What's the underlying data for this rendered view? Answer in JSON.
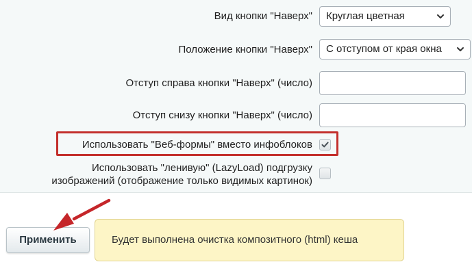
{
  "settings": {
    "button_type": {
      "label": "Вид кнопки \"Наверх\"",
      "value": "Круглая цветная"
    },
    "button_position": {
      "label": "Положение кнопки \"Наверх\"",
      "value": "С отступом от края окна"
    },
    "offset_right": {
      "label": "Отступ справа кнопки \"Наверх\" (число)",
      "value": ""
    },
    "offset_bottom": {
      "label": "Отступ снизу кнопки \"Наверх\" (число)",
      "value": ""
    },
    "use_webforms": {
      "label": "Использовать \"Веб-формы\" вместо инфоблоков",
      "checked": true
    },
    "lazyload": {
      "label_line1": "Использовать \"ленивую\" (LazyLoad) подгрузку",
      "label_line2": "изображений (отображение только видимых картинок)",
      "checked": false
    }
  },
  "footer": {
    "apply_label": "Применить",
    "notice_text": "Будет выполнена очистка композитного (html) кеша"
  },
  "colors": {
    "highlight": "#c32f2c",
    "notice_bg": "#fdf5c6",
    "panel_bg": "#f5f9f9"
  },
  "icons": {
    "select_arrow": "chevron-down-icon",
    "check": "checkmark-icon",
    "annotation_arrow": "red-arrow-icon"
  }
}
